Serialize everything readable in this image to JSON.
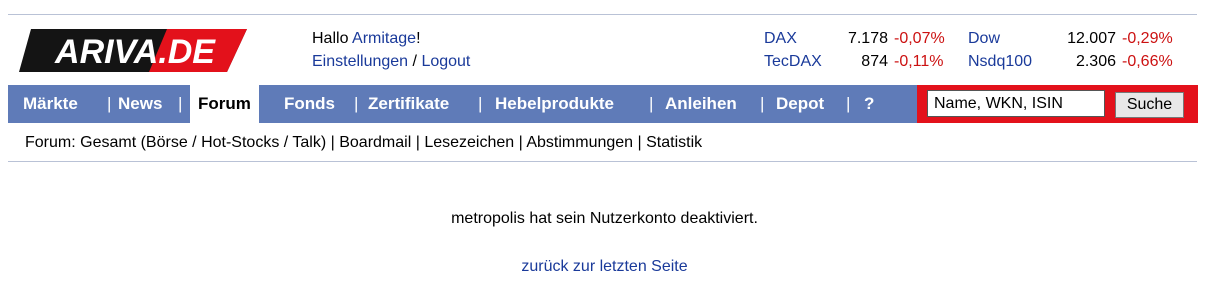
{
  "logo": {
    "text": "ARIVA.DE"
  },
  "greeting": {
    "hello": "Hallo",
    "username": "Armitage",
    "exclaim": "!",
    "settings": "Einstellungen",
    "slash": "/",
    "logout": "Logout"
  },
  "quotes": [
    {
      "name": "DAX",
      "value": "7.178",
      "change": "-0,07%"
    },
    {
      "name": "Dow",
      "value": "12.007",
      "change": "-0,29%"
    },
    {
      "name": "TecDAX",
      "value": "874",
      "change": "-0,11%"
    },
    {
      "name": "Nsdq100",
      "value": "2.306",
      "change": "-0,66%"
    }
  ],
  "nav": {
    "items": [
      "Märkte",
      "News",
      "Forum",
      "Fonds",
      "Zertifikate",
      "Hebelprodukte",
      "Anleihen",
      "Depot",
      "?"
    ],
    "active": "Forum",
    "separator": "|"
  },
  "search": {
    "placeholder": "Name, WKN, ISIN",
    "button": "Suche"
  },
  "subnav": {
    "prefix": "Forum:",
    "gesamt": "Gesamt",
    "paren_open": "(",
    "boerse": "Börse",
    "sep_slash": "/",
    "hotstocks": "Hot-Stocks",
    "talk": "Talk",
    "paren_close": ")",
    "boardmail": "Boardmail",
    "lesezeichen": "Lesezeichen",
    "abstimmungen": "Abstimmungen",
    "statistik": "Statistik",
    "sep": "|"
  },
  "message": "metropolis hat sein Nutzerkonto deaktiviert.",
  "back_link": "zurück zur letzten Seite",
  "colors": {
    "nav_bg": "#5f7bb8",
    "search_bg": "#e3111b",
    "link": "#1a3a9a",
    "negative": "#cc1111"
  }
}
